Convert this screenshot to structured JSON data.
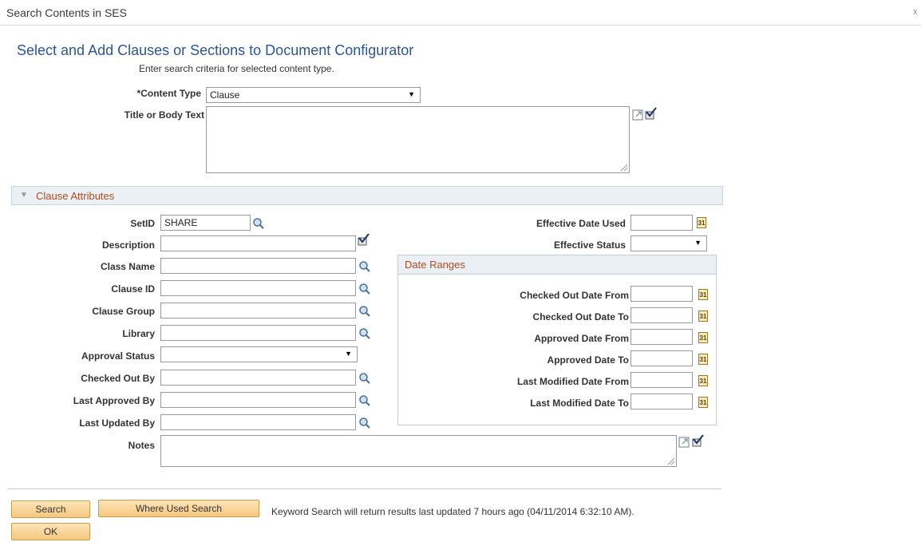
{
  "window": {
    "title": "Search Contents in SES",
    "close_label": "x"
  },
  "page": {
    "title": "Select and Add Clauses or Sections to Document Configurator",
    "instructions": "Enter search criteria for selected content type."
  },
  "form": {
    "content_type": {
      "label": "*Content Type",
      "value": "Clause"
    },
    "title_body": {
      "label": "Title or Body Text",
      "value": ""
    }
  },
  "section": {
    "label": "Clause Attributes"
  },
  "attributes": {
    "setid": {
      "label": "SetID",
      "value": "SHARE"
    },
    "description": {
      "label": "Description",
      "value": ""
    },
    "class_name": {
      "label": "Class Name",
      "value": ""
    },
    "clause_id": {
      "label": "Clause ID",
      "value": ""
    },
    "clause_group": {
      "label": "Clause Group",
      "value": ""
    },
    "library": {
      "label": "Library",
      "value": ""
    },
    "approval_status": {
      "label": "Approval Status",
      "value": ""
    },
    "checked_out_by": {
      "label": "Checked Out By",
      "value": ""
    },
    "last_approved_by": {
      "label": "Last Approved By",
      "value": ""
    },
    "last_updated_by": {
      "label": "Last Updated By",
      "value": ""
    },
    "notes": {
      "label": "Notes",
      "value": ""
    },
    "effective_date_used": {
      "label": "Effective Date Used",
      "value": ""
    },
    "effective_status": {
      "label": "Effective Status",
      "value": ""
    }
  },
  "date_ranges": {
    "title": "Date Ranges",
    "checked_out_from": {
      "label": "Checked Out Date From",
      "value": ""
    },
    "checked_out_to": {
      "label": "Checked Out Date To",
      "value": ""
    },
    "approved_from": {
      "label": "Approved Date From",
      "value": ""
    },
    "approved_to": {
      "label": "Approved Date To",
      "value": ""
    },
    "last_modified_from": {
      "label": "Last Modified Date From",
      "value": ""
    },
    "last_modified_to": {
      "label": "Last Modified Date To",
      "value": ""
    }
  },
  "buttons": {
    "search": "Search",
    "where_used": "Where Used Search",
    "ok": "OK"
  },
  "footer": {
    "keyword_info": "Keyword Search will return results last updated 7 hours ago (04/11/2014 6:32:10 AM)."
  },
  "icons": {
    "lookup": "magnifier-icon",
    "spell": "spellcheck-icon",
    "expand": "expand-icon",
    "calendar": "calendar-icon",
    "calendar_glyph": "31"
  },
  "colors": {
    "title_blue": "#2a5597",
    "section_orange": "#b04a20",
    "button": "#f5c77e"
  }
}
